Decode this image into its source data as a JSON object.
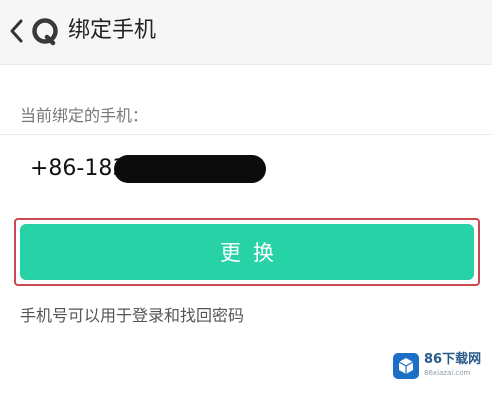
{
  "header": {
    "back_icon": "chevron-left-icon",
    "logo_icon": "app-logo-icon",
    "title": "绑定手机"
  },
  "main": {
    "current_label": "当前绑定的手机：",
    "phone_visible": "+86-183",
    "phone_masked": true,
    "change_button_label": "更换",
    "hint": "手机号可以用于登录和找回密码"
  },
  "watermark": {
    "text": "86下载网",
    "url": "86xiazai.com"
  },
  "colors": {
    "accent": "#27d2a7",
    "highlight_border": "#c8494f",
    "header_bg": "#f6f6f6"
  }
}
